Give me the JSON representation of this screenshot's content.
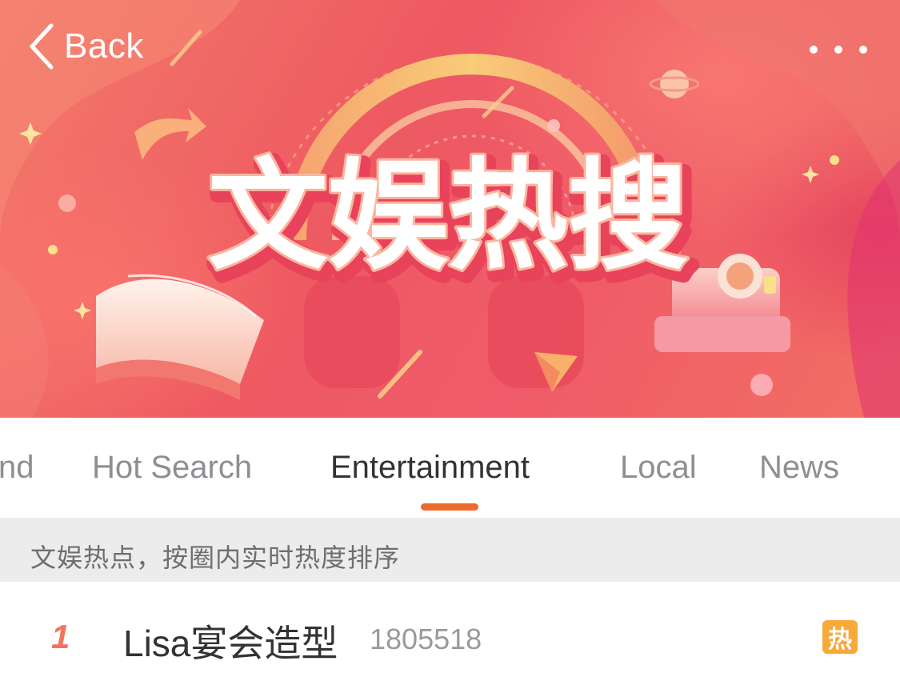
{
  "nav": {
    "back_label": "Back",
    "more_icon": "more-dots-icon",
    "back_icon": "chevron-left-icon"
  },
  "banner": {
    "title": "文娱热搜",
    "colors": {
      "primary": "#ee5a62",
      "accent": "#f7c66a"
    }
  },
  "tabs": [
    {
      "label": "nd",
      "active": false
    },
    {
      "label": "Hot Search",
      "active": false
    },
    {
      "label": "Entertainment",
      "active": true
    },
    {
      "label": "Local",
      "active": false
    },
    {
      "label": "News",
      "active": false
    }
  ],
  "accent_color": "#ee6a2c",
  "subtitle": "文娱热点，按圈内实时热度排序",
  "list": [
    {
      "rank": "1",
      "title": "Lisa宴会造型",
      "count": "1805518",
      "badge": "热"
    }
  ]
}
